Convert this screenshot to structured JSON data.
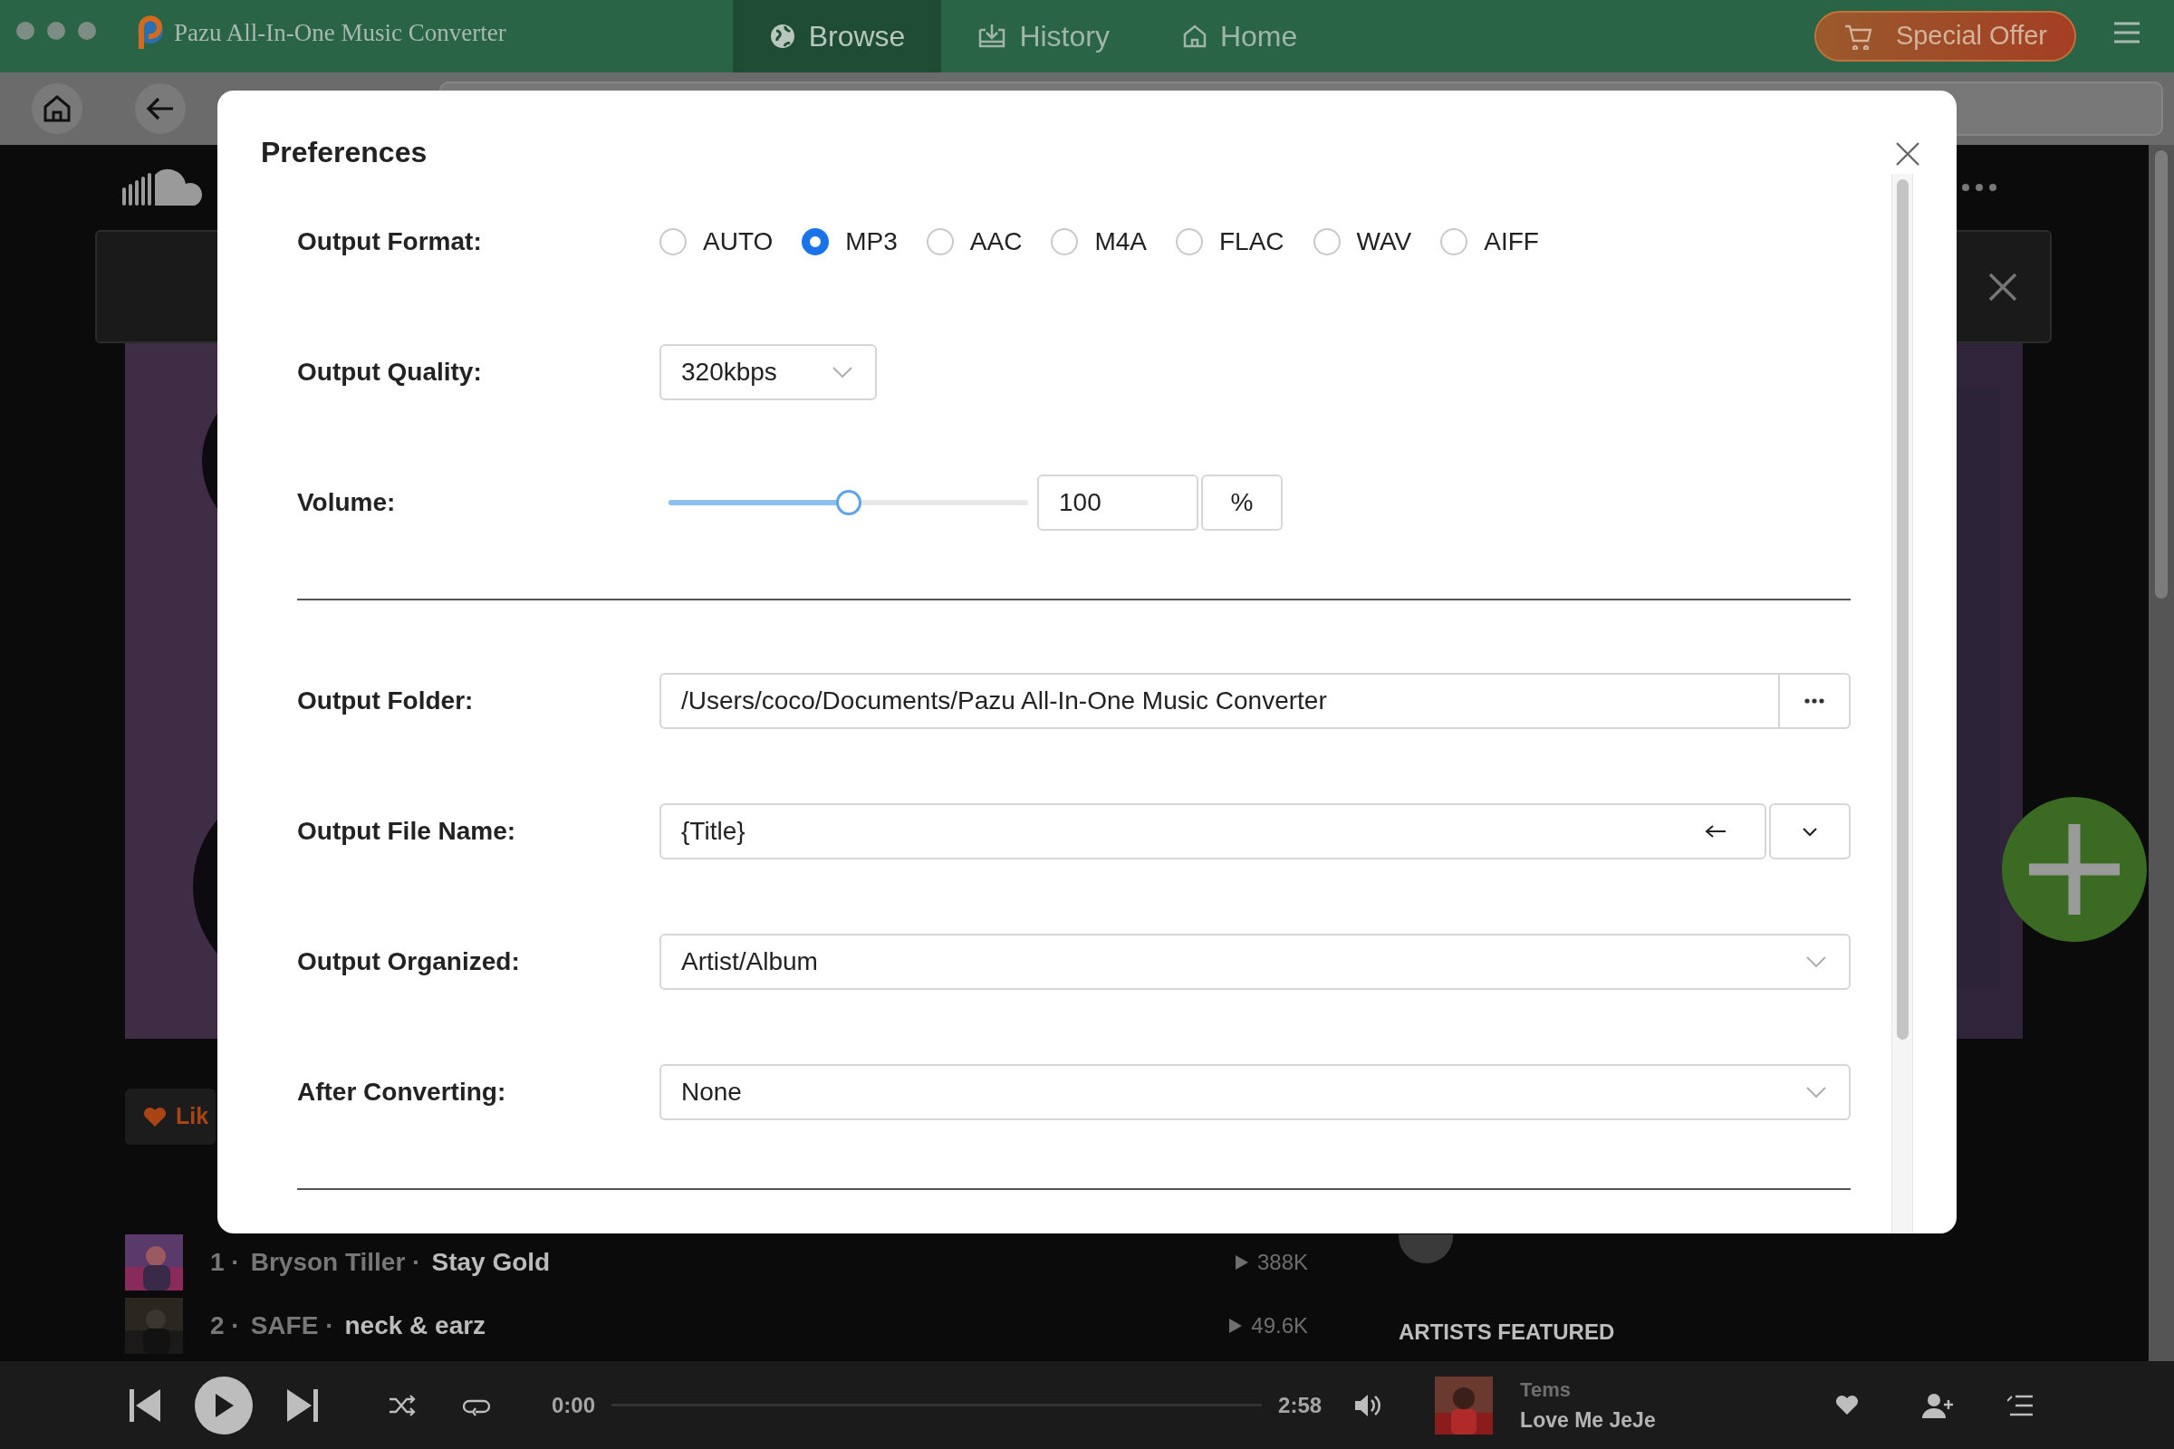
{
  "app": {
    "title": "Pazu All-In-One Music Converter"
  },
  "nav_tabs": [
    {
      "label": "Browse",
      "selected": true
    },
    {
      "label": "History",
      "selected": false
    },
    {
      "label": "Home",
      "selected": false
    }
  ],
  "special_offer": {
    "label": "Special Offer"
  },
  "browser": {
    "like_button": {
      "label": "Lik"
    },
    "tracks": [
      {
        "number": "1 ·",
        "artist": "Bryson Tiller ·",
        "title": "Stay Gold",
        "plays": "388K"
      },
      {
        "number": "2 ·",
        "artist": "SAFE ·",
        "title": "neck & earz",
        "plays": "49.6K"
      }
    ],
    "section_heading": "ARTISTS FEATURED"
  },
  "player": {
    "elapsed": "0:00",
    "level": 0,
    "duration": "2:58",
    "artist": "Tems",
    "title": "Love Me JeJe"
  },
  "preferences": {
    "title": "Preferences",
    "fields": [
      {
        "kind": "radio",
        "label": "Output Format:",
        "options": [
          {
            "label": "AUTO",
            "selected": false
          },
          {
            "label": "MP3",
            "selected": true
          },
          {
            "label": "AAC",
            "selected": false
          },
          {
            "label": "M4A",
            "selected": false
          },
          {
            "label": "FLAC",
            "selected": false
          },
          {
            "label": "WAV",
            "selected": false
          },
          {
            "label": "AIFF",
            "selected": false
          }
        ]
      },
      {
        "kind": "picker",
        "label": "Output Quality:",
        "value": "320kbps"
      },
      {
        "kind": "slider",
        "label": "Volume:",
        "level": 0.5,
        "value": "100",
        "unit": "%"
      },
      {
        "kind": "folder",
        "label": "Output Folder:",
        "value": "/Users/coco/Documents/Pazu All-In-One Music Converter"
      },
      {
        "kind": "template",
        "label": "Output File Name:",
        "value": "{Title}"
      },
      {
        "kind": "select",
        "label": "Output Organized:",
        "value": "Artist/Album"
      },
      {
        "kind": "select",
        "label": "After Converting:",
        "value": "None"
      }
    ]
  }
}
